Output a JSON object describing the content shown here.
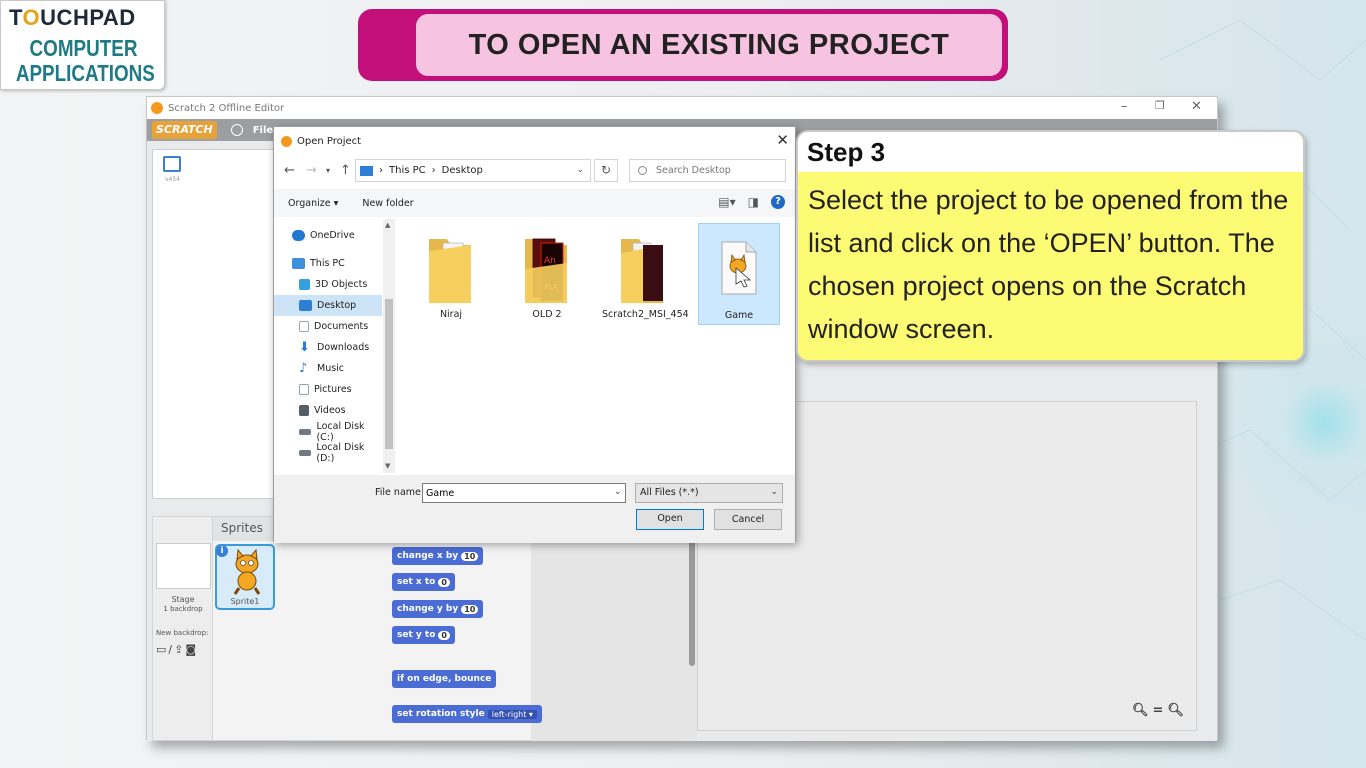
{
  "logo": {
    "brand_pre": "T",
    "brand_o": "O",
    "brand_post": "UCHPAD",
    "line1": "COMPUTER",
    "line2": "APPLICATIONS"
  },
  "banner": {
    "title": "TO OPEN AN EXISTING PROJECT"
  },
  "scratch": {
    "window_title": "Scratch 2 Offline Editor",
    "logo": "SCRATCH",
    "file_menu": "File ▾",
    "version": "v454",
    "sprites_label": "Sprites",
    "stage_label": "Stage",
    "stage_sub": "1 backdrop",
    "new_backdrop": "New backdrop:",
    "sprite_name": "Sprite1",
    "blocks": [
      {
        "text": "change x by",
        "value": "10"
      },
      {
        "text": "set x to",
        "value": "0"
      },
      {
        "text": "change y by",
        "value": "10"
      },
      {
        "text": "set y to",
        "value": "0"
      },
      {
        "text": "if on edge, bounce"
      },
      {
        "text": "set rotation style",
        "option": "left-right ▾"
      }
    ]
  },
  "dialog": {
    "title": "Open Project",
    "path": [
      "This PC",
      "Desktop"
    ],
    "search_placeholder": "Search Desktop",
    "organize": "Organize ▾",
    "new_folder": "New folder",
    "nav_items": [
      {
        "label": "OneDrive",
        "icon": "cloud-icon",
        "color": "#1f78d1"
      },
      {
        "label": "This PC",
        "icon": "computer-icon",
        "color": "#3d8fe0"
      },
      {
        "label": "3D Objects",
        "icon": "cube-icon",
        "color": "#35a0e0"
      },
      {
        "label": "Desktop",
        "icon": "desktop-icon",
        "color": "#2d7fd6"
      },
      {
        "label": "Documents",
        "icon": "document-icon",
        "color": "#9aa3ad"
      },
      {
        "label": "Downloads",
        "icon": "download-icon",
        "color": "#2b7bd3"
      },
      {
        "label": "Music",
        "icon": "music-icon",
        "color": "#2b7bd3"
      },
      {
        "label": "Pictures",
        "icon": "pictures-icon",
        "color": "#8ea0b2"
      },
      {
        "label": "Videos",
        "icon": "video-icon",
        "color": "#555d66"
      },
      {
        "label": "Local Disk (C:)",
        "icon": "disk-icon",
        "color": "#6f7a85"
      },
      {
        "label": "Local Disk (D:)",
        "icon": "disk-icon",
        "color": "#6f7a85"
      }
    ],
    "files": [
      {
        "name": "Niraj",
        "type": "folder"
      },
      {
        "name": "OLD 2",
        "type": "folder-animate"
      },
      {
        "name": "Scratch2_MSI_454",
        "type": "folder-dark"
      },
      {
        "name": "Game",
        "type": "scratch-file"
      }
    ],
    "file_name_label": "File name:",
    "file_name_value": "Game",
    "file_type": "All Files (*.*)",
    "open_label": "Open",
    "cancel_label": "Cancel"
  },
  "callout": {
    "title": "Step 3",
    "text": "Select the project to be opened from the list and click on the ‘OPEN’ button. The chosen project opens on the Scratch window screen."
  }
}
